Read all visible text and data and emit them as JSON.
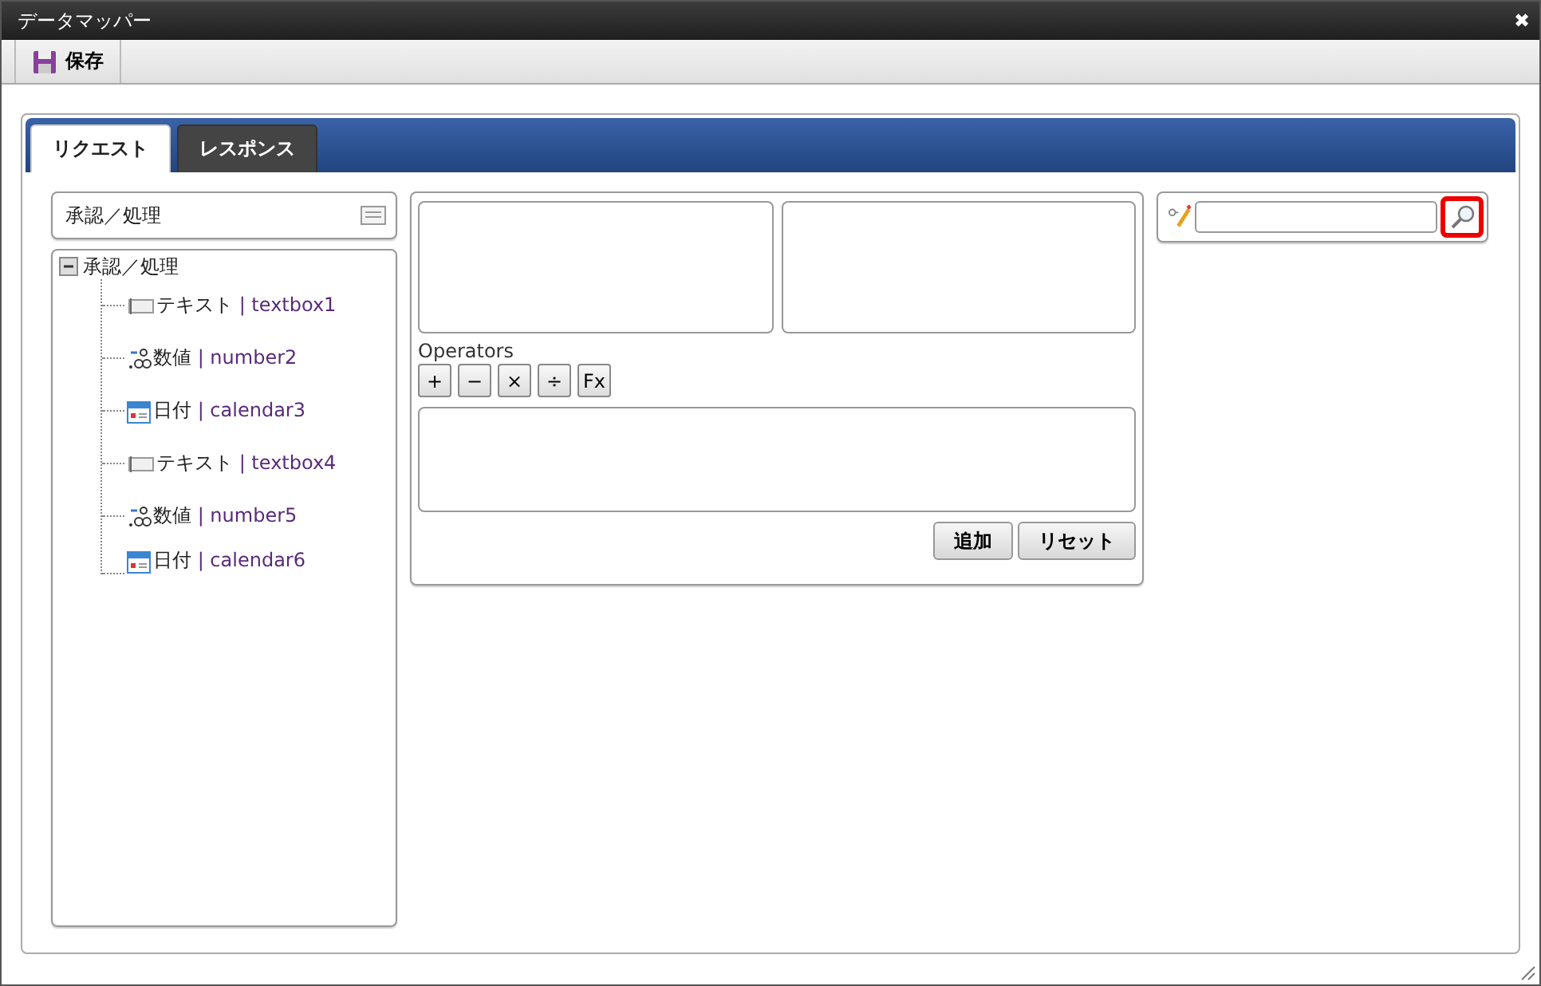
{
  "window": {
    "title": "データマッパー",
    "close": "✖"
  },
  "toolbar": {
    "save": "保存"
  },
  "tabs": [
    {
      "label": "リクエスト",
      "selected": true
    },
    {
      "label": "レスポンス",
      "selected": false
    }
  ],
  "tree_header": {
    "title": "承認／処理"
  },
  "tree": {
    "label": "承認／処理",
    "expanded": true,
    "children": [
      {
        "kind": "textbox",
        "name": "テキスト",
        "field": "| textbox1"
      },
      {
        "kind": "number",
        "name": "数値",
        "field": "| number2"
      },
      {
        "kind": "calendar",
        "name": "日付",
        "field": "| calendar3"
      },
      {
        "kind": "textbox",
        "name": "テキスト",
        "field": "| textbox4"
      },
      {
        "kind": "number",
        "name": "数値",
        "field": "| number5"
      },
      {
        "kind": "calendar",
        "name": "日付",
        "field": "| calendar6"
      }
    ]
  },
  "operators": {
    "label": "Operators",
    "buttons": [
      "+",
      "−",
      "×",
      "÷",
      "Fx"
    ]
  },
  "actions": [
    "追加",
    "リセット"
  ],
  "search": {
    "highlighted": true
  }
}
